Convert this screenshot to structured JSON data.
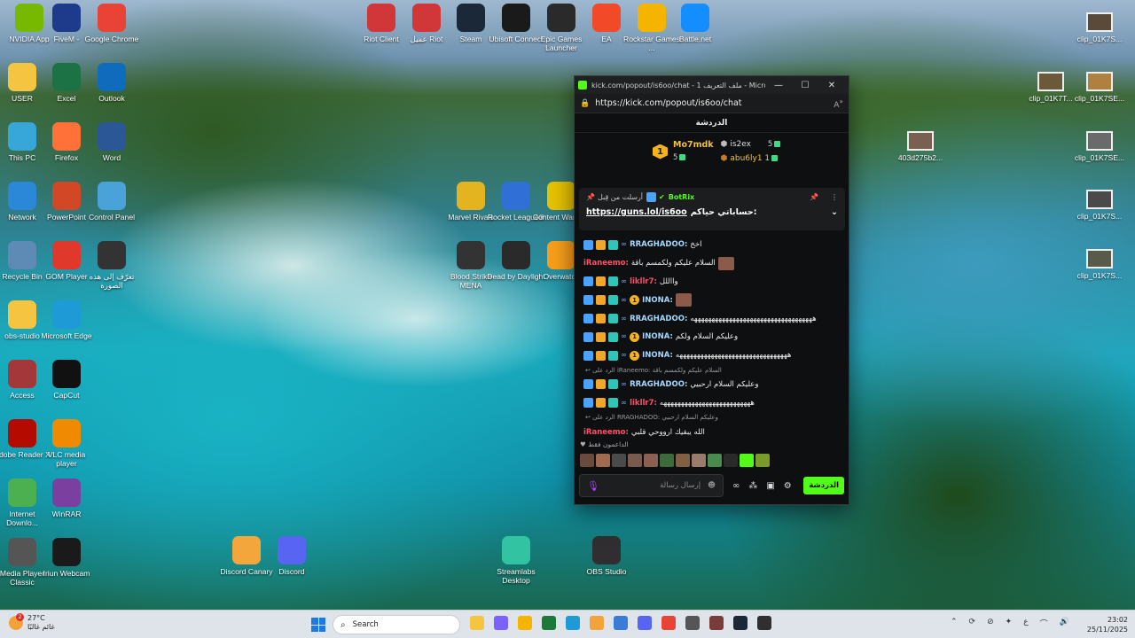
{
  "desktop_icons": [
    {
      "label": "NVIDIA App",
      "icon": "nvidia-icon",
      "color": "#76b900"
    },
    {
      "label": "FiveM -",
      "icon": "fivem-icon",
      "color": "#1e3a8a"
    },
    {
      "label": "Google Chrome",
      "icon": "chrome-icon",
      "color": "#e84335"
    },
    {
      "label": "USER",
      "icon": "folder-icon",
      "color": "#f5c542"
    },
    {
      "label": "Excel",
      "icon": "excel-icon",
      "color": "#1d7245"
    },
    {
      "label": "Outlook",
      "icon": "outlook-icon",
      "color": "#0f6cbd"
    },
    {
      "label": "This PC",
      "icon": "pc-icon",
      "color": "#37a6d8"
    },
    {
      "label": "Firefox",
      "icon": "firefox-icon",
      "color": "#ff7139"
    },
    {
      "label": "Word",
      "icon": "word-icon",
      "color": "#2b5797"
    },
    {
      "label": "Network",
      "icon": "network-icon",
      "color": "#2b88d8"
    },
    {
      "label": "PowerPoint",
      "icon": "powerpoint-icon",
      "color": "#d24726"
    },
    {
      "label": "Control Panel",
      "icon": "control-panel-icon",
      "color": "#4aa3d8"
    },
    {
      "label": "Recycle Bin",
      "icon": "recycle-bin-icon",
      "color": "#5d8bb5"
    },
    {
      "label": "GOM Player",
      "icon": "gom-player-icon",
      "color": "#e0382a"
    },
    {
      "label": "تعرّف إلى هذه الصورة",
      "icon": "spotlight-icon",
      "color": "#333333"
    },
    {
      "label": "obs-studio",
      "icon": "folder-icon",
      "color": "#f5c542"
    },
    {
      "label": "Microsoft Edge",
      "icon": "edge-icon",
      "color": "#1e9bd7"
    },
    {
      "label": "Access",
      "icon": "access-icon",
      "color": "#a4373a"
    },
    {
      "label": "CapCut",
      "icon": "capcut-icon",
      "color": "#111111"
    },
    {
      "label": "Adobe Reader X",
      "icon": "adobe-reader-icon",
      "color": "#b30b00"
    },
    {
      "label": "VLC media player",
      "icon": "vlc-icon",
      "color": "#f08a00"
    },
    {
      "label": "Internet Downlo...",
      "icon": "idm-icon",
      "color": "#4caf50"
    },
    {
      "label": "WinRAR",
      "icon": "winrar-icon",
      "color": "#7b3fa0"
    },
    {
      "label": "Media Player Classic",
      "icon": "mpc-icon",
      "color": "#555555"
    },
    {
      "label": "Iriun Webcam",
      "icon": "webcam-icon",
      "color": "#1a1a1a"
    },
    {
      "label": "Riot Client",
      "icon": "riot-icon",
      "color": "#d13639"
    },
    {
      "label": "عميل Riot",
      "icon": "riot-icon",
      "color": "#d13639"
    },
    {
      "label": "Steam",
      "icon": "steam-icon",
      "color": "#1b2838"
    },
    {
      "label": "Ubisoft Connect",
      "icon": "ubisoft-icon",
      "color": "#1a1a1a"
    },
    {
      "label": "Epic Games Launcher",
      "icon": "epic-icon",
      "color": "#2a2a2a"
    },
    {
      "label": "EA",
      "icon": "ea-icon",
      "color": "#f24a29"
    },
    {
      "label": "Rockstar Games ...",
      "icon": "rockstar-icon",
      "color": "#f4b400"
    },
    {
      "label": "Battle.net",
      "icon": "battlenet-icon",
      "color": "#148eff"
    },
    {
      "label": "Marvel Rivals",
      "icon": "marvel-rivals-icon",
      "color": "#e3b420"
    },
    {
      "label": "Rocket League®",
      "icon": "rocket-league-icon",
      "color": "#2f6fd6"
    },
    {
      "label": "Content Warning",
      "icon": "content-warning-icon",
      "color": "#e6c200"
    },
    {
      "label": "Blood Strike MENA",
      "icon": "blood-strike-icon",
      "color": "#333333"
    },
    {
      "label": "Dead by Daylight",
      "icon": "dbd-icon",
      "color": "#2a2a2a"
    },
    {
      "label": "Overwatch",
      "icon": "overwatch-icon",
      "color": "#f99e1a"
    },
    {
      "label": "Discord Canary",
      "icon": "discord-canary-icon",
      "color": "#f3a63b"
    },
    {
      "label": "Discord",
      "icon": "discord-icon",
      "color": "#5865f2"
    },
    {
      "label": "Streamlabs Desktop",
      "icon": "streamlabs-icon",
      "color": "#31c3a2"
    },
    {
      "label": "OBS Studio",
      "icon": "obs-icon",
      "color": "#302e31"
    },
    {
      "label": "clip_01K7S...",
      "icon": "video-thumbnail-icon",
      "color": "#5a4a3a"
    },
    {
      "label": "clip_01K7T...",
      "icon": "video-thumbnail-icon",
      "color": "#6a5a3a"
    },
    {
      "label": "clip_01K7SE...",
      "icon": "video-thumbnail-icon",
      "color": "#b08040"
    },
    {
      "label": "403d275b2...",
      "icon": "video-thumbnail-icon",
      "color": "#7a6050"
    },
    {
      "label": "clip_01K7SE...",
      "icon": "video-thumbnail-icon",
      "color": "#6a6a6a"
    },
    {
      "label": "clip_01K7S...",
      "icon": "video-thumbnail-icon",
      "color": "#4a4a4a"
    },
    {
      "label": "clip_01K7S...",
      "icon": "video-thumbnail-icon",
      "color": "#5a5a4a"
    }
  ],
  "chat_window": {
    "title": "kick.com/popout/is6oo/chat - ملف التعريف 1 - Microso...",
    "url": "https://kick.com/popout/is6oo/chat",
    "header": "الدردشة",
    "leaderboard": {
      "first": {
        "name": "Mo7mdk",
        "count": "5"
      },
      "second": {
        "name": "is2ex",
        "count": "5"
      },
      "third": {
        "name": "abu6ly1",
        "count": "1"
      }
    },
    "pinned": {
      "pinned_by": "أرسلت من قِبل",
      "bot_name": "BotRix",
      "link": "https://guns.lol/is6oo",
      "text": "حساباتي حياكم:"
    },
    "messages": [
      {
        "user": "RRAGHADOO:",
        "text": "اخخ",
        "user_color": "cyan",
        "badges": 3
      },
      {
        "user": "iRaneemo:",
        "text": "السلام عليكم ولكمسم باقة",
        "user_color": "red",
        "badges": 0,
        "emote": true
      },
      {
        "user": "likllr7:",
        "text": "وااللل",
        "user_color": "red",
        "badges": 3
      },
      {
        "user": "INONA:",
        "text": "",
        "user_color": "cyan",
        "badges": 3,
        "num": "1",
        "emote": true
      },
      {
        "user": "RRAGHADOO:",
        "text": "هههههههههههههههههههههههههههههههههههه",
        "user_color": "cyan",
        "badges": 3
      },
      {
        "user": "INONA:",
        "text": "وعليكم السلام ولكم",
        "user_color": "cyan",
        "badges": 3,
        "num": "1"
      },
      {
        "user": "INONA:",
        "text": "ههههههههههههههههههههههههههههههههه",
        "user_color": "cyan",
        "badges": 3,
        "num": "1"
      },
      {
        "reply": "الرد على iRaneemo: السلام عليكم ولكمسم باقة"
      },
      {
        "user": "RRAGHADOO:",
        "text": "وعليكم السلام ارحبيي",
        "user_color": "cyan",
        "badges": 3
      },
      {
        "user": "likllr7:",
        "text": "ههههههههههههههههههههههههههه",
        "user_color": "red",
        "badges": 3
      },
      {
        "reply": "الرد على RRAGHADOO: وعليكم السلام ارحبيي"
      },
      {
        "user": "iRaneemo:",
        "text": "الله يبقيك ارووحي قلبي",
        "user_color": "red",
        "badges": 0
      }
    ],
    "supporters_label": "الداعمون فقط",
    "input_placeholder": "إرسال رسالة",
    "send_label": "الدردشة"
  },
  "taskbar": {
    "temperature": "27°C",
    "weather_text": "غائم غالبًا",
    "notification_count": "2",
    "search_placeholder": "Search",
    "language": "ع",
    "time": "23:02",
    "date": "25/11/2025",
    "apps": [
      {
        "name": "file-explorer-icon",
        "color": "#f5c542"
      },
      {
        "name": "copilot-icon",
        "color": "#7b61ff"
      },
      {
        "name": "folder-icon",
        "color": "#f5b400"
      },
      {
        "name": "app-icon",
        "color": "#1b7a3a"
      },
      {
        "name": "edge-icon",
        "color": "#1e9bd7"
      },
      {
        "name": "app-icon",
        "color": "#f2a33a"
      },
      {
        "name": "app-icon",
        "color": "#3a7bd5"
      },
      {
        "name": "discord-icon",
        "color": "#5865f2"
      },
      {
        "name": "chrome-icon",
        "color": "#e84335"
      },
      {
        "name": "app-icon",
        "color": "#555555"
      },
      {
        "name": "app-icon",
        "color": "#7a3b3b"
      },
      {
        "name": "steam-icon",
        "color": "#1b2838"
      },
      {
        "name": "obs-icon",
        "color": "#302e31"
      }
    ]
  }
}
